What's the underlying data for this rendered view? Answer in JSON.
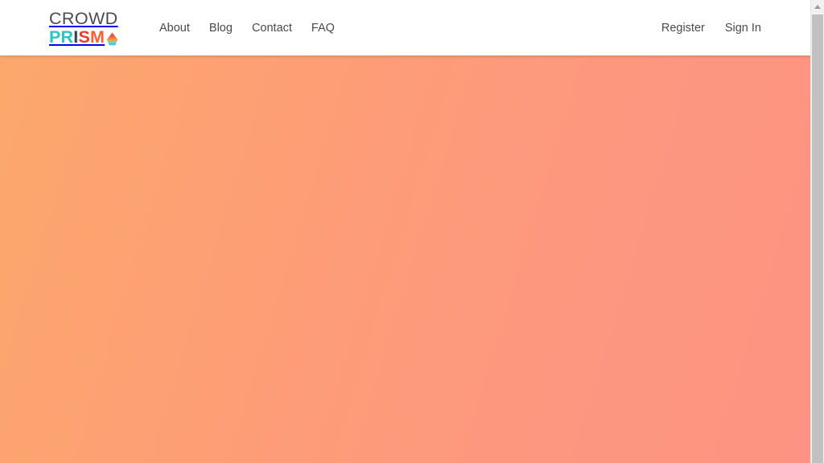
{
  "brand": {
    "line1": "CROWD",
    "line2_letters": [
      {
        "char": "P",
        "color": "#2ec4c0"
      },
      {
        "char": "R",
        "color": "#2ec4c0"
      },
      {
        "char": "I",
        "color": "#3b3f4a"
      },
      {
        "char": "S",
        "color": "#f0392b"
      },
      {
        "char": "M",
        "color": "#f4622f"
      }
    ],
    "line2": "PRISM",
    "icon": "prism-droplet-icon",
    "full_name": "CROWD PRISM"
  },
  "nav": {
    "items": [
      {
        "label": "About",
        "name": "nav-link-about"
      },
      {
        "label": "Blog",
        "name": "nav-link-blog"
      },
      {
        "label": "Contact",
        "name": "nav-link-contact"
      },
      {
        "label": "FAQ",
        "name": "nav-link-faq"
      }
    ],
    "account": [
      {
        "label": "Register",
        "name": "nav-link-register"
      },
      {
        "label": "Sign In",
        "name": "nav-link-signin"
      }
    ]
  },
  "hero": {
    "content": "",
    "gradient_start": "#fca86c",
    "gradient_end": "#fd9382"
  },
  "scrollbar": {
    "up_arrow": "scroll-up-arrow-icon",
    "track_color": "#f1f1f1",
    "thumb_color": "#c1c1c1"
  },
  "colors": {
    "header_bg": "#ffffff",
    "nav_text": "#4a4a4a",
    "brand_dark": "#4c4c4c"
  }
}
